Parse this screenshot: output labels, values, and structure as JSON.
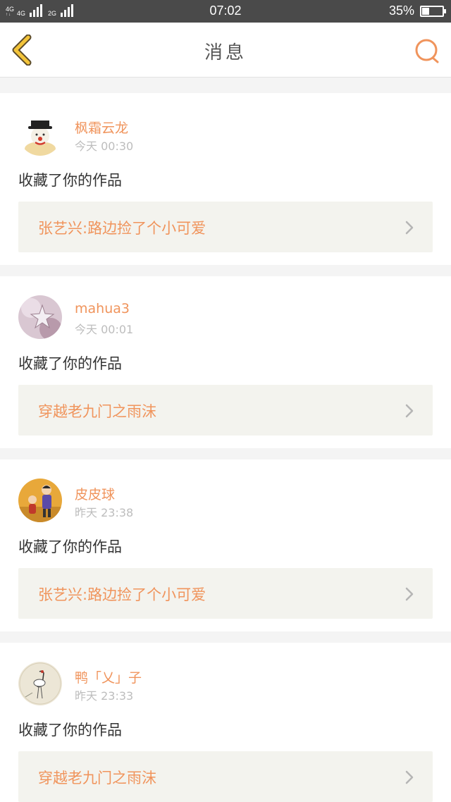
{
  "status_bar": {
    "net1": "4G",
    "net2": "4G",
    "net3": "2G",
    "time": "07:02",
    "battery": "35%",
    "battery_level": 0.35
  },
  "header": {
    "title": "消息",
    "back_icon": "chevron-left-icon",
    "search_icon": "search-icon"
  },
  "colors": {
    "accent": "#f0945c",
    "back_icon": "#f3c43a",
    "page_bg": "#f4f4f4"
  },
  "messages": [
    {
      "username": "枫霜云龙",
      "time": "今天 00:30",
      "action": "收藏了你的作品",
      "work_title": "张艺兴:路边捡了个小可爱"
    },
    {
      "username": "mahua3",
      "time": "今天 00:01",
      "action": "收藏了你的作品",
      "work_title": "穿越老九门之雨沫"
    },
    {
      "username": "皮皮球",
      "time": "昨天 23:38",
      "action": "收藏了你的作品",
      "work_title": "张艺兴:路边捡了个小可爱"
    },
    {
      "username": "鸭「乂」子",
      "time": "昨天 23:33",
      "action": "收藏了你的作品",
      "work_title": "穿越老九门之雨沫"
    }
  ]
}
